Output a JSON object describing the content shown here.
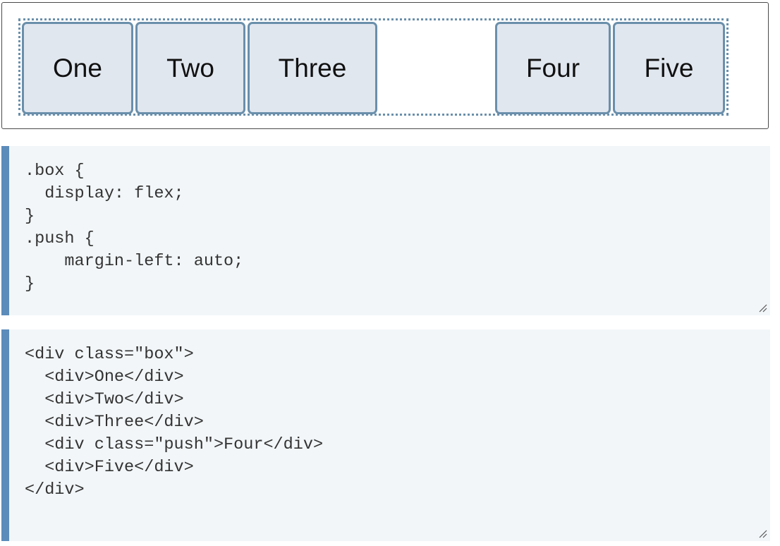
{
  "preview": {
    "items": [
      {
        "label": "One"
      },
      {
        "label": "Two"
      },
      {
        "label": "Three"
      },
      {
        "label": "Four"
      },
      {
        "label": "Five"
      }
    ]
  },
  "css_editor": {
    "code": ".box {\n  display: flex;\n}\n.push {\n    margin-left: auto;\n}"
  },
  "html_editor": {
    "code": "<div class=\"box\">\n  <div>One</div>\n  <div>Two</div>\n  <div>Three</div>\n  <div class=\"push\">Four</div>\n  <div>Five</div>\n</div>"
  },
  "colors": {
    "item_border": "#6a8fab",
    "item_background": "#e1e7ef",
    "editor_background": "#f2f6f8",
    "editor_accent": "#5c8cba"
  },
  "icons": {
    "resize": "resize-handle-icon"
  }
}
